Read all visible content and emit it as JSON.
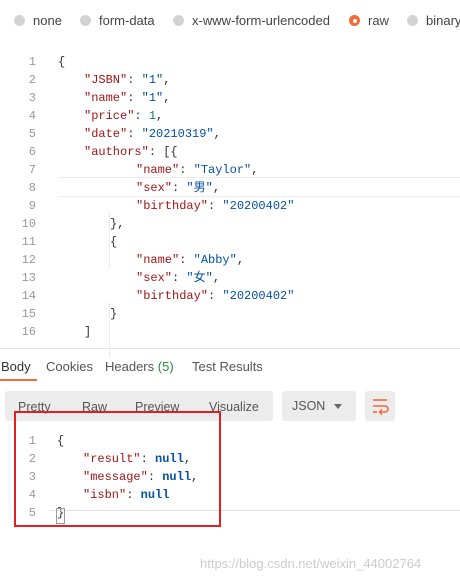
{
  "body_types": {
    "options": [
      {
        "label": "none",
        "selected": false
      },
      {
        "label": "form-data",
        "selected": false
      },
      {
        "label": "x-www-form-urlencoded",
        "selected": false
      },
      {
        "label": "raw",
        "selected": true
      },
      {
        "label": "binary",
        "selected": false
      }
    ]
  },
  "request_editor": {
    "line_numbers": [
      "1",
      "2",
      "3",
      "4",
      "5",
      "6",
      "7",
      "8",
      "9",
      "10",
      "11",
      "12",
      "13",
      "14",
      "15",
      "16"
    ],
    "lines": [
      {
        "indent": 0,
        "tokens": [
          {
            "t": "p",
            "v": "{"
          }
        ]
      },
      {
        "indent": 1,
        "tokens": [
          {
            "t": "k",
            "v": "\"JSBN\""
          },
          {
            "t": "p",
            "v": ": "
          },
          {
            "t": "s",
            "v": "\"1\""
          },
          {
            "t": "p",
            "v": ","
          }
        ]
      },
      {
        "indent": 1,
        "tokens": [
          {
            "t": "k",
            "v": "\"name\""
          },
          {
            "t": "p",
            "v": ": "
          },
          {
            "t": "s",
            "v": "\"1\""
          },
          {
            "t": "p",
            "v": ","
          }
        ]
      },
      {
        "indent": 1,
        "tokens": [
          {
            "t": "k",
            "v": "\"price\""
          },
          {
            "t": "p",
            "v": ": "
          },
          {
            "t": "n",
            "v": "1"
          },
          {
            "t": "p",
            "v": ","
          }
        ]
      },
      {
        "indent": 1,
        "tokens": [
          {
            "t": "k",
            "v": "\"date\""
          },
          {
            "t": "p",
            "v": ": "
          },
          {
            "t": "s",
            "v": "\"20210319\""
          },
          {
            "t": "p",
            "v": ","
          }
        ]
      },
      {
        "indent": 1,
        "tokens": [
          {
            "t": "k",
            "v": "\"authors\""
          },
          {
            "t": "p",
            "v": ": [{"
          }
        ]
      },
      {
        "indent": 3,
        "tokens": [
          {
            "t": "k",
            "v": "\"name\""
          },
          {
            "t": "p",
            "v": ": "
          },
          {
            "t": "s",
            "v": "\"Taylor\""
          },
          {
            "t": "p",
            "v": ","
          }
        ]
      },
      {
        "indent": 3,
        "tokens": [
          {
            "t": "k",
            "v": "\"sex\""
          },
          {
            "t": "p",
            "v": ": "
          },
          {
            "t": "s",
            "v": "\"男\""
          },
          {
            "t": "p",
            "v": ","
          }
        ]
      },
      {
        "indent": 3,
        "tokens": [
          {
            "t": "k",
            "v": "\"birthday\""
          },
          {
            "t": "p",
            "v": ": "
          },
          {
            "t": "s",
            "v": "\"20200402\""
          }
        ]
      },
      {
        "indent": 2,
        "tokens": [
          {
            "t": "p",
            "v": "},"
          }
        ]
      },
      {
        "indent": 2,
        "tokens": [
          {
            "t": "p",
            "v": "{"
          }
        ]
      },
      {
        "indent": 3,
        "tokens": [
          {
            "t": "k",
            "v": "\"name\""
          },
          {
            "t": "p",
            "v": ": "
          },
          {
            "t": "s",
            "v": "\"Abby\""
          },
          {
            "t": "p",
            "v": ","
          }
        ]
      },
      {
        "indent": 3,
        "tokens": [
          {
            "t": "k",
            "v": "\"sex\""
          },
          {
            "t": "p",
            "v": ": "
          },
          {
            "t": "s",
            "v": "\"女\""
          },
          {
            "t": "p",
            "v": ","
          }
        ]
      },
      {
        "indent": 3,
        "tokens": [
          {
            "t": "k",
            "v": "\"birthday\""
          },
          {
            "t": "p",
            "v": ": "
          },
          {
            "t": "s",
            "v": "\"20200402\""
          }
        ]
      },
      {
        "indent": 2,
        "tokens": [
          {
            "t": "p",
            "v": "}"
          }
        ]
      },
      {
        "indent": 1,
        "tokens": [
          {
            "t": "p",
            "v": "]"
          }
        ]
      }
    ]
  },
  "response_tabs": [
    {
      "label": "Body",
      "active": true
    },
    {
      "label": "Cookies",
      "active": false
    },
    {
      "label": "Headers",
      "count": "(5)",
      "active": false
    },
    {
      "label": "Test Results",
      "active": false
    }
  ],
  "toolbar": {
    "view_modes": [
      "Pretty",
      "Raw",
      "Preview",
      "Visualize"
    ],
    "format": "JSON",
    "wrap_icon": "text-wrap-icon"
  },
  "response": {
    "line_numbers": [
      "1",
      "2",
      "3",
      "4",
      "5"
    ],
    "lines": [
      {
        "indent": 0,
        "tokens": [
          {
            "t": "p",
            "v": "{"
          }
        ]
      },
      {
        "indent": 1,
        "tokens": [
          {
            "t": "kk",
            "v": "\"result\""
          },
          {
            "t": "p",
            "v": ": "
          },
          {
            "t": "nl",
            "v": "null"
          },
          {
            "t": "p",
            "v": ","
          }
        ]
      },
      {
        "indent": 1,
        "tokens": [
          {
            "t": "kk",
            "v": "\"message\""
          },
          {
            "t": "p",
            "v": ": "
          },
          {
            "t": "nl",
            "v": "null"
          },
          {
            "t": "p",
            "v": ","
          }
        ]
      },
      {
        "indent": 1,
        "tokens": [
          {
            "t": "kk",
            "v": "\"isbn\""
          },
          {
            "t": "p",
            "v": ": "
          },
          {
            "t": "nl",
            "v": "null"
          }
        ]
      },
      {
        "indent": 0,
        "tokens": [
          {
            "t": "p",
            "v": "}"
          }
        ]
      }
    ]
  },
  "watermark": "https://blog.csdn.net/weixin_44002764",
  "colors": {
    "accent": "#f26b3a",
    "highlight_box": "#e02020",
    "headers_count": "#2a8a3e"
  }
}
